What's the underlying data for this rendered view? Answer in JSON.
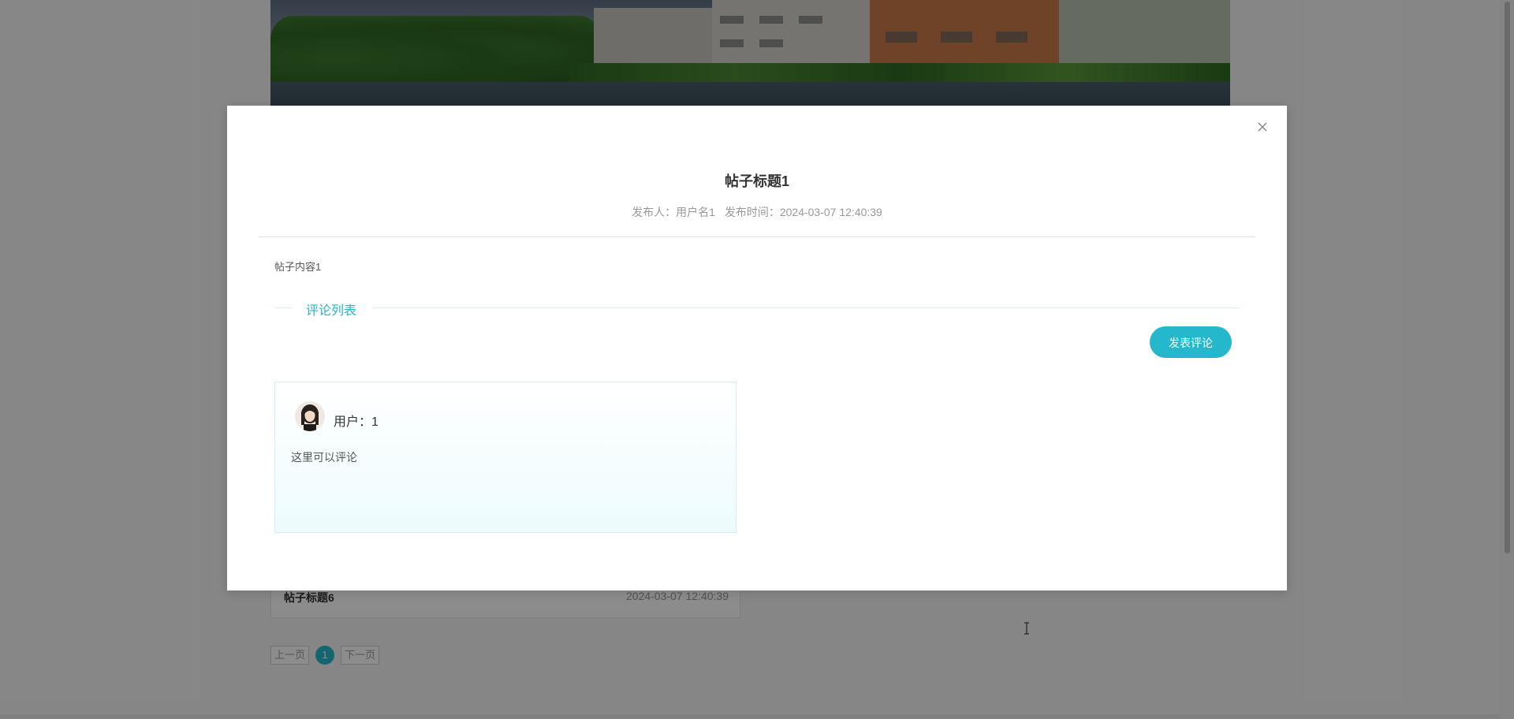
{
  "background": {
    "list_item": {
      "title": "帖子标题6",
      "date": "2024-03-07 12:40:39"
    },
    "pagination": {
      "prev_label": "上一页",
      "current_page": "1",
      "next_label": "下一页"
    }
  },
  "modal": {
    "close_icon": "close-icon",
    "post": {
      "title": "帖子标题1",
      "author_label": "发布人：用户名1",
      "time_label": "发布时间：2024-03-07 12:40:39",
      "content": "帖子内容1"
    },
    "comments_section": {
      "heading": "评论列表",
      "add_button_label": "发表评论",
      "items": [
        {
          "user": "用户：1",
          "text": "这里可以评论"
        }
      ]
    }
  },
  "colors": {
    "accent": "#25b8cc",
    "overlay": "rgba(0,0,0,0.45)"
  }
}
